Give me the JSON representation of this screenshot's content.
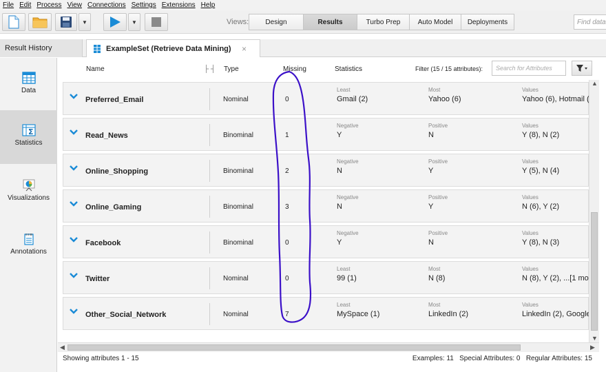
{
  "menu": [
    "File",
    "Edit",
    "Process",
    "View",
    "Connections",
    "Settings",
    "Extensions",
    "Help"
  ],
  "views": {
    "label": "Views:",
    "tabs": [
      "Design",
      "Results",
      "Turbo Prep",
      "Auto Model",
      "Deployments"
    ],
    "active": "Results"
  },
  "find": {
    "placeholder": "Find data,"
  },
  "tabs": {
    "history": "Result History",
    "example": "ExampleSet (Retrieve Data Mining)",
    "close": "×"
  },
  "sidenav": [
    "Data",
    "Statistics",
    "Visualizations",
    "Annotations"
  ],
  "columns": {
    "name": "Name",
    "type": "Type",
    "missing": "Missing",
    "statistics": "Statistics",
    "filter": "Filter (15 / 15 attributes):",
    "filter_placeholder": "Search for Attributes"
  },
  "rows": [
    {
      "name": "Preferred_Email",
      "type": "Nominal",
      "missing": "0",
      "l1": "Least",
      "v1": "Gmail (2)",
      "l2": "Most",
      "v2": "Yahoo (6)",
      "l3": "Values",
      "v3": "Yahoo (6), Hotmail ("
    },
    {
      "name": "Read_News",
      "type": "Binominal",
      "missing": "1",
      "l1": "Negative",
      "v1": "Y",
      "l2": "Positive",
      "v2": "N",
      "l3": "Values",
      "v3": "Y (8), N (2)"
    },
    {
      "name": "Online_Shopping",
      "type": "Binominal",
      "missing": "2",
      "l1": "Negative",
      "v1": "N",
      "l2": "Positive",
      "v2": "Y",
      "l3": "Values",
      "v3": "Y (5), N (4)"
    },
    {
      "name": "Online_Gaming",
      "type": "Binominal",
      "missing": "3",
      "l1": "Negative",
      "v1": "N",
      "l2": "Positive",
      "v2": "Y",
      "l3": "Values",
      "v3": "N (6), Y (2)"
    },
    {
      "name": "Facebook",
      "type": "Binominal",
      "missing": "0",
      "l1": "Negative",
      "v1": "Y",
      "l2": "Positive",
      "v2": "N",
      "l3": "Values",
      "v3": "Y (8), N (3)"
    },
    {
      "name": "Twitter",
      "type": "Nominal",
      "missing": "0",
      "l1": "Least",
      "v1": "99 (1)",
      "l2": "Most",
      "v2": "N (8)",
      "l3": "Values",
      "v3": "N (8), Y (2), ...[1 mo"
    },
    {
      "name": "Other_Social_Network",
      "type": "Nominal",
      "missing": "7",
      "l1": "Least",
      "v1": "MySpace (1)",
      "l2": "Most",
      "v2": "LinkedIn (2)",
      "l3": "Values",
      "v3": "LinkedIn (2), Google"
    }
  ],
  "status": {
    "left": "Showing attributes 1 - 15",
    "right": "Examples: 11   Special Attributes: 0   Regular Attributes: 15"
  },
  "colors": {
    "accent": "#1a8bd6",
    "annotation": "#3b10c8",
    "active_tab": "#cfcfcf"
  }
}
